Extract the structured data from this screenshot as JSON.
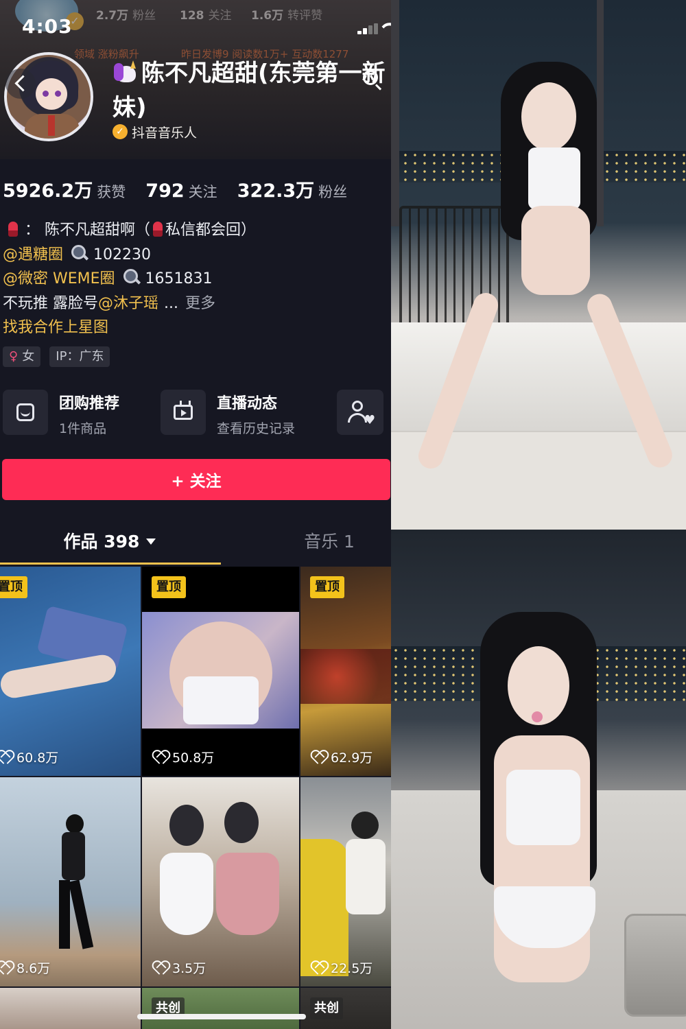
{
  "status_bar": {
    "time": "4:03"
  },
  "header_overlay": {
    "followers_count": "2.7万",
    "followers_label": "粉丝",
    "following_count": "128",
    "following_label": "关注",
    "reposts_count": "1.6万",
    "reposts_label": "转评赞",
    "activity_left": "领域 涨粉飙升",
    "activity_right": "昨日发博9 阅读数1万+ 互动数1277"
  },
  "profile": {
    "name": "陈不凡超甜(东莞第一新妹)",
    "verification": "抖音音乐人"
  },
  "stats": [
    {
      "value": "5926.2万",
      "label": "获赞"
    },
    {
      "value": "792",
      "label": "关注"
    },
    {
      "value": "322.3万",
      "label": "粉丝"
    }
  ],
  "bio": {
    "line1_a": "：  陈不凡超甜啊（",
    "line1_b": "私信都会回）",
    "line2_link": "@遇糖圈",
    "line2_num": "102230",
    "line3_link": "@微密 WEME圈",
    "line3_num": "1651831",
    "line4_text": "不玩推  露脸号",
    "line4_link": "@沐子瑶",
    "line4_ellipsis": "...",
    "line4_more": "更多",
    "line5_link": "找我合作上星图"
  },
  "tags": {
    "gender_icon": "♀",
    "gender": "女",
    "ip": "IP：广东"
  },
  "features": [
    {
      "title": "团购推荐",
      "subtitle": "1件商品",
      "icon": "shop-icon"
    },
    {
      "title": "直播动态",
      "subtitle": "查看历史记录",
      "icon": "tv-icon"
    }
  ],
  "follow_button": "+ 关注",
  "tabs": {
    "works": "作品 398",
    "music": "音乐 1"
  },
  "grid": {
    "pin_label": "置顶",
    "cocreate_label": "共创",
    "tiles": [
      {
        "likes": "60.8万"
      },
      {
        "likes": "50.8万"
      },
      {
        "likes": "62.9万"
      },
      {
        "likes": "8.6万"
      },
      {
        "likes": "3.5万"
      },
      {
        "likes": "22.5万"
      }
    ]
  },
  "colors": {
    "accent": "#fe2c55",
    "link": "#f2c14e",
    "pin": "#f3c21b",
    "background": "#161722"
  }
}
